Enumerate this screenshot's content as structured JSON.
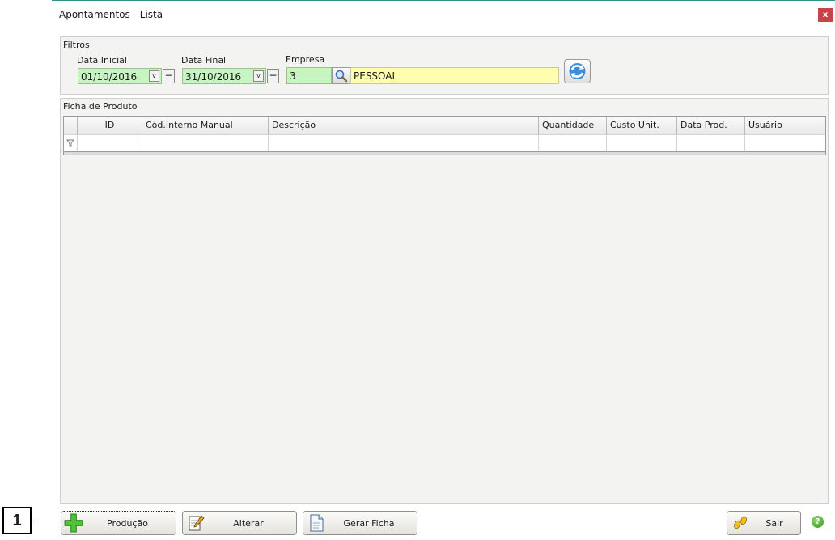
{
  "window": {
    "title": "Apontamentos - Lista",
    "close_label": "x"
  },
  "filters": {
    "group_label": "Filtros",
    "data_inicial_label": "Data Inicial",
    "data_inicial_value": "01/10/2016",
    "data_final_label": "Data Final",
    "data_final_value": "31/10/2016",
    "empresa_label": "Empresa",
    "empresa_code": "3",
    "empresa_name": "PESSOAL",
    "minus_symbol": "−",
    "dropdown_symbol": "v"
  },
  "grid": {
    "group_label": "Ficha de Produto",
    "columns": [
      "ID",
      "Cód.Interno Manual",
      "Descrição",
      "Quantidade",
      "Custo Unit.",
      "Data Prod.",
      "Usuário"
    ]
  },
  "buttons": {
    "producao": "Produção",
    "alterar": "Alterar",
    "gerar_ficha": "Gerar Ficha",
    "sair": "Sair"
  },
  "callout": {
    "number": "1"
  },
  "help": {
    "symbol": "?"
  },
  "colors": {
    "date_field_bg": "#c6f5c2",
    "name_field_bg": "#fffdb0",
    "close_bg": "#c8424a"
  },
  "icons": [
    "search-icon",
    "refresh-icon",
    "filter-icon",
    "plus-icon",
    "edit-icon",
    "document-icon",
    "footsteps-icon",
    "help-icon"
  ]
}
